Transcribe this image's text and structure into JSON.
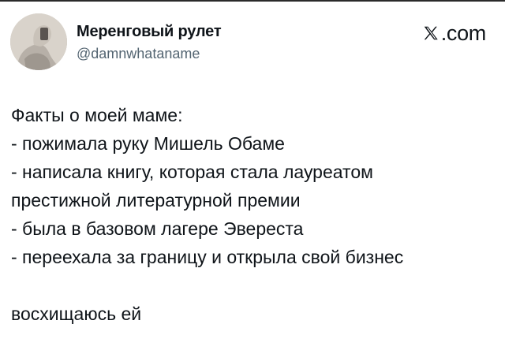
{
  "author": {
    "display_name": "Меренговый рулет",
    "handle": "@damnwhataname",
    "avatar_icon": "profile-photo"
  },
  "brand": {
    "logo_icon": "x-logo-icon",
    "label": ".com"
  },
  "tweet": {
    "lines": [
      "Факты о моей маме:",
      "- пожимала руку Мишель Обаме",
      "- написала книгу, которая стала лауреатом",
      "престижной литературной премии",
      "- была в базовом лагере Эвереста",
      "- переехала за границу и открыла свой бизнес",
      "",
      "восхищаюсь ей"
    ]
  },
  "colors": {
    "text": "#0f1419",
    "secondary_text": "#536471",
    "background": "#ffffff"
  }
}
